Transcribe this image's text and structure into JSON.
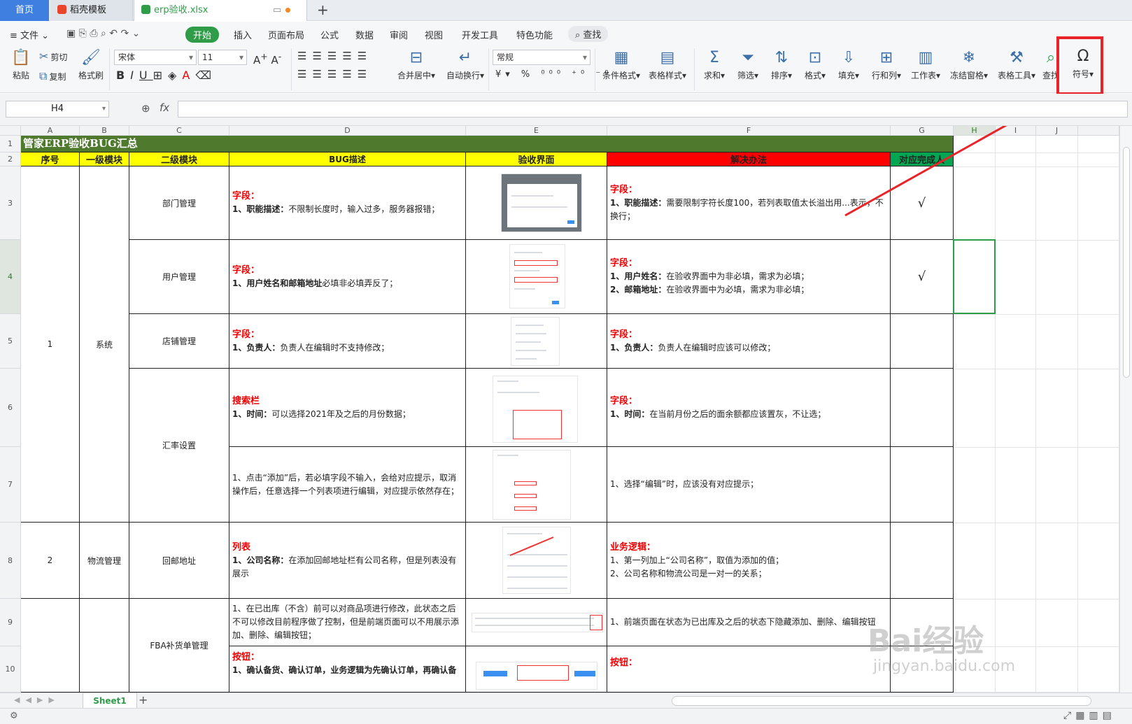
{
  "tabs": {
    "home": "首页",
    "template": "稻壳模板",
    "file": "erp验收.xlsx",
    "new": "+"
  },
  "menu": {
    "file": "文件",
    "items": [
      "开始",
      "插入",
      "页面布局",
      "公式",
      "数据",
      "审阅",
      "视图",
      "开发工具",
      "特色功能"
    ],
    "search": "查找"
  },
  "ribbon": {
    "paste": "粘贴",
    "cut": "剪切",
    "copy": "复制",
    "format_painter": "格式刷",
    "font_name": "宋体",
    "font_size": "11",
    "number_format": "常规",
    "merge": "合并居中",
    "wrap": "自动换行",
    "cond_format": "条件格式",
    "table_style": "表格样式",
    "sum": "求和",
    "filter": "筛选",
    "sort": "排序",
    "format": "格式",
    "fill": "填充",
    "rowcol": "行和列",
    "worksheet": "工作表",
    "freeze": "冻结窗格",
    "table_tool": "表格工具",
    "find": "查找",
    "symbol": "符号",
    "accent_color": "#2f9c48",
    "highlight_color": "#e8232a"
  },
  "formula_bar": {
    "cell_ref": "H4",
    "fx": "fx",
    "value": ""
  },
  "columns": [
    "A",
    "B",
    "C",
    "D",
    "E",
    "F",
    "G",
    "H",
    "I",
    "J"
  ],
  "rows": [
    "1",
    "2",
    "3",
    "4",
    "5",
    "6",
    "7",
    "8",
    "9",
    "10"
  ],
  "sheet": {
    "title": "管家ERP验收BUG汇总",
    "headers": [
      "序号",
      "一级模块",
      "二级模块",
      "BUG描述",
      "验收界面",
      "解决办法",
      "对应完成人"
    ],
    "header_colors": {
      "default": "#ffff00",
      "solution": "#ff0000",
      "owner": "#00a651",
      "title_bg": "#4f7a2e"
    },
    "groups": [
      {
        "no": "1",
        "module": "系统"
      },
      {
        "no": "2",
        "module": "物流管理"
      }
    ],
    "submodules": [
      "部门管理",
      "用户管理",
      "店铺管理",
      "汇率设置",
      "回邮地址",
      "FBA补货单管理"
    ],
    "r3": {
      "d_head": "字段：",
      "d_label": "1、职能描述：",
      "d_text": "不限制长度时，输入过多，服务器报错；",
      "f_head": "字段：",
      "f_label": "1、职能描述：",
      "f_text": "需要限制字符长度100，若列表取值太长溢出用...表示，不换行；",
      "done": "√"
    },
    "r4": {
      "d_head": "字段：",
      "d_label": "1、用户姓名和邮箱地址",
      "d_text": "必填非必填弄反了；",
      "f_head": "字段：",
      "f_label1": "1、用户姓名：",
      "f_text1": "在验收界面中为非必填，需求为必填；",
      "f_label2": "2、邮箱地址：",
      "f_text2": "在验收界面中为必填，需求为非必填；",
      "done": "√"
    },
    "r5": {
      "d_head": "字段：",
      "d_label": "1、负责人：",
      "d_text": "负责人在编辑时不支持修改；",
      "f_head": "字段：",
      "f_label": "1、负责人：",
      "f_text": "负责人在编辑时应该可以修改；"
    },
    "r6": {
      "d_head": "搜索栏",
      "d_label": "1、时间：",
      "d_text": "可以选择2021年及之后的月份数据；",
      "f_head": "字段：",
      "f_label": "1、时间：",
      "f_text": "在当前月份之后的面余额都应该置灰，不让选；"
    },
    "r7": {
      "d_text": "1、点击“添加”后，若必填字段不输入，会给对应提示，取消操作后，任意选择一个列表项进行编辑，对应提示依然存在；",
      "f_text": "1、选择“编辑”时，应该没有对应提示；"
    },
    "r8": {
      "d_head": "列表",
      "d_label": "1、公司名称：",
      "d_text": "在添加回邮地址栏有公司名称，但是列表没有展示",
      "f_head": "业务逻辑：",
      "f_text1": "1、第一列加上“公司名称”，取值为添加的值；",
      "f_text2": "2、公司名称和物流公司是一对一的关系；"
    },
    "r9": {
      "d_text": "1、在已出库（不含）前可以对商品项进行修改，此状态之后不可以修改目前程序做了控制，但是前端页面可以不用展示添加、删除、编辑按钮；",
      "f_text": "1、前端页面在状态为已出库及之后的状态下隐藏添加、删除、编辑按钮"
    },
    "r10": {
      "d_head": "按钮：",
      "d_text": "1、确认备货、确认订单，业务逻辑为先确认订单，再确认备",
      "f_head": "按钮："
    }
  },
  "sheet_tab": "Sheet1",
  "watermark": {
    "brand": "Bai经验",
    "url": "jingyan.baidu.com"
  }
}
